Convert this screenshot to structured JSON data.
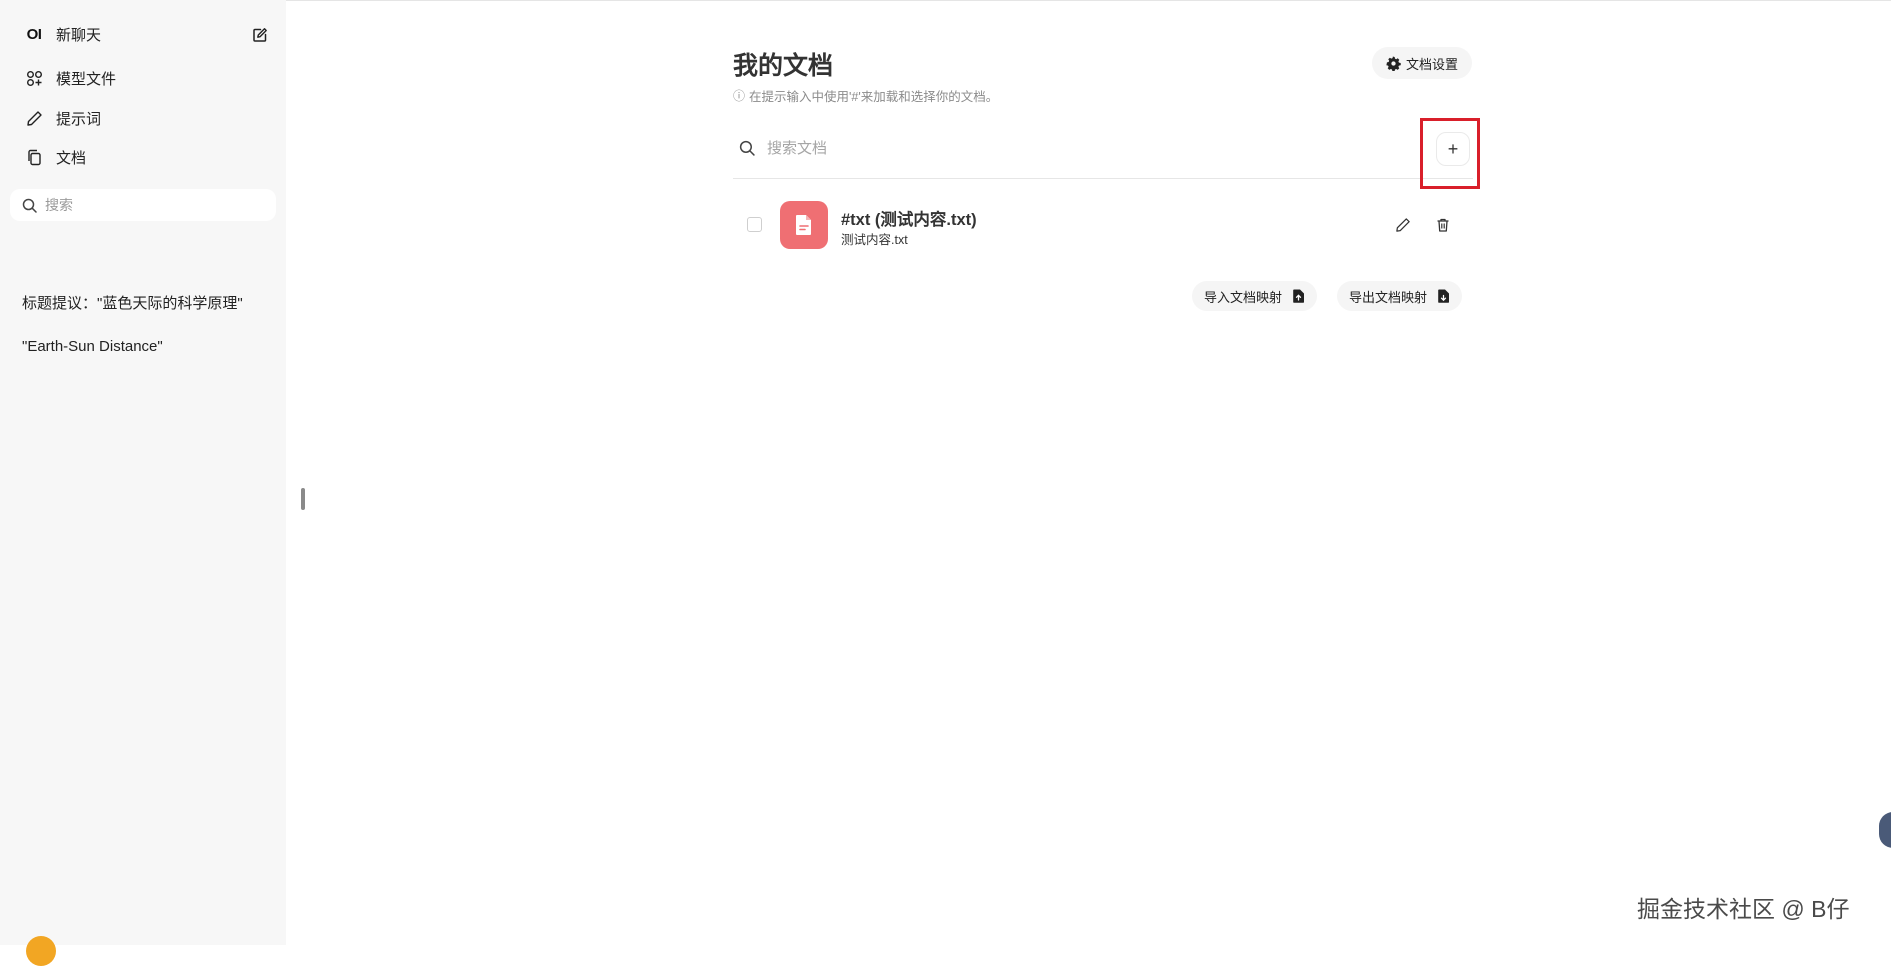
{
  "sidebar": {
    "logo": "OI",
    "new_chat": "新聊天",
    "items": [
      {
        "label": "模型文件",
        "icon": "modelfiles-icon"
      },
      {
        "label": "提示词",
        "icon": "pencil-icon"
      },
      {
        "label": "文档",
        "icon": "documents-icon"
      }
    ],
    "search_placeholder": "搜索",
    "chats": [
      "标题提议：\"蓝色天际的科学原理\"",
      "\"Earth-Sun Distance\""
    ]
  },
  "main": {
    "title": "我的文档",
    "hint": "在提示输入中使用'#'来加载和选择你的文档。",
    "settings_label": "文档设置",
    "search_placeholder": "搜索文档",
    "add_label": "+",
    "documents": [
      {
        "name": "#txt (测试内容.txt)",
        "filename": "测试内容.txt"
      }
    ],
    "import_label": "导入文档映射",
    "export_label": "导出文档映射"
  },
  "watermark": "掘金技术社区 @ B仔",
  "colors": {
    "sidebar_bg": "#f7f7f7",
    "file_icon": "#ef6f73",
    "highlight": "#d91f2a",
    "avatar": "#f2a623"
  }
}
